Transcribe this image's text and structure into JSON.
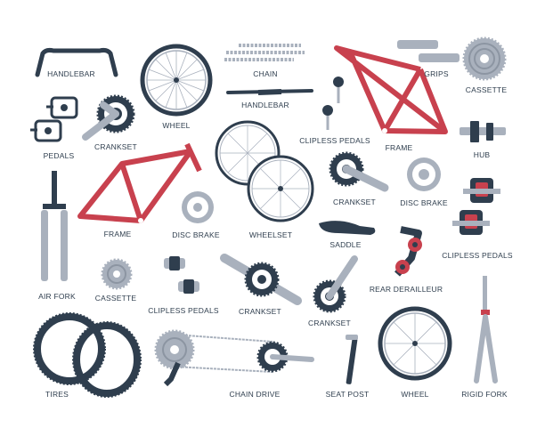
{
  "colors": {
    "navy": "#2f3e4e",
    "grey": "#a9b1bd",
    "red": "#c8414e",
    "light": "#d7dce3"
  },
  "labels": {
    "handlebar_1": "HANDLEBAR",
    "wheel_1": "WHEEL",
    "chain": "CHAIN",
    "handlebar_2": "HANDLEBAR",
    "grips": "GRIPS",
    "cassette_1": "CASSETTE",
    "pedals": "PEDALS",
    "crankset_1": "CRANKSET",
    "clipless_pedals_1": "CLIPLESS PEDALS",
    "frame_1": "FRAME",
    "hub": "HUB",
    "crankset_2": "CRANKSET",
    "disc_brake_1": "DISC BRAKE",
    "frame_2": "FRAME",
    "disc_brake_2": "DISC BRAKE",
    "wheelset": "WHEELSET",
    "saddle": "SADDLE",
    "clipless_pedals_2": "CLIPLESS PEDALS",
    "air_fork": "AIR FORK",
    "cassette_2": "CASSETTE",
    "clipless_pedals_3": "CLIPLESS PEDALS",
    "crankset_3": "CRANKSET",
    "crankset_4": "CRANKSET",
    "rear_derailleur": "REAR DERAILLEUR",
    "tires": "TIRES",
    "chain_drive": "CHAIN DRIVE",
    "seat_post": "SEAT POST",
    "wheel_2": "WHEEL",
    "rigid_fork": "RIGID FORK"
  }
}
